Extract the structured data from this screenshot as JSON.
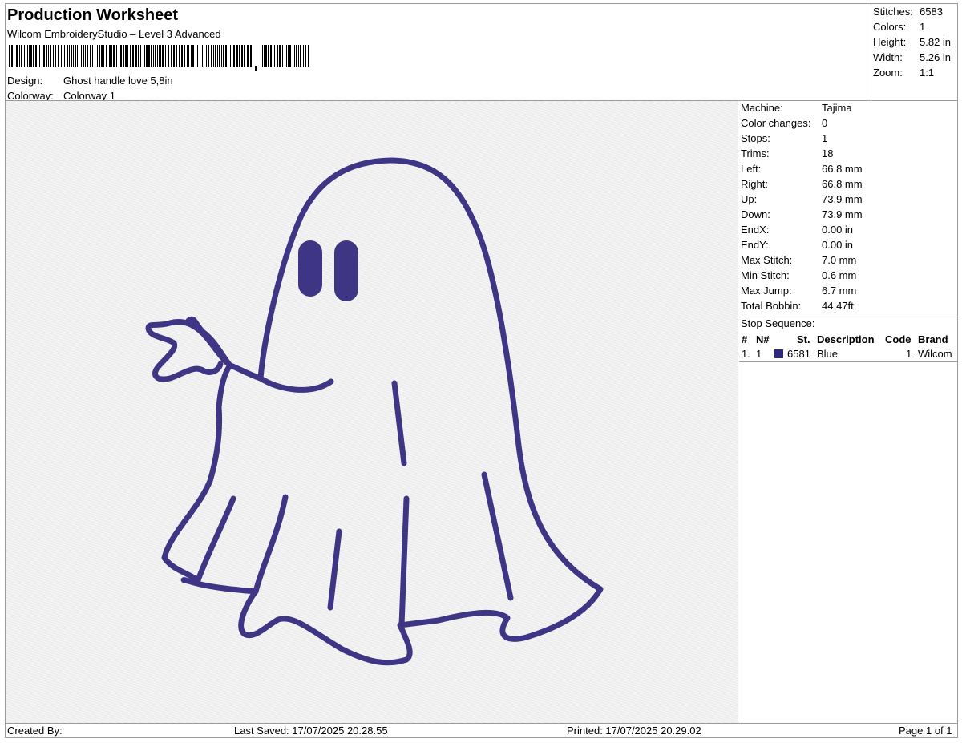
{
  "header": {
    "title": "Production Worksheet",
    "software": "Wilcom EmbroideryStudio – Level 3 Advanced",
    "design_label": "Design:",
    "design_value": "Ghost handle love 5,8in",
    "colorway_label": "Colorway:",
    "colorway_value": "Colorway 1"
  },
  "summary": {
    "stitches_label": "Stitches:",
    "stitches": "6583",
    "colors_label": "Colors:",
    "colors": "1",
    "height_label": "Height:",
    "height": "5.82 in",
    "width_label": "Width:",
    "width": "5.26 in",
    "zoom_label": "Zoom:",
    "zoom": "1:1"
  },
  "details": [
    {
      "label": "Machine:",
      "value": "Tajima"
    },
    {
      "label": "Color changes:",
      "value": "0"
    },
    {
      "label": "Stops:",
      "value": "1"
    },
    {
      "label": "Trims:",
      "value": "18"
    },
    {
      "label": "Left:",
      "value": "66.8 mm"
    },
    {
      "label": "Right:",
      "value": "66.8 mm"
    },
    {
      "label": "Up:",
      "value": "73.9 mm"
    },
    {
      "label": "Down:",
      "value": "73.9 mm"
    },
    {
      "label": "EndX:",
      "value": "0.00 in"
    },
    {
      "label": "EndY:",
      "value": "0.00 in"
    },
    {
      "label": "Max Stitch:",
      "value": "7.0 mm"
    },
    {
      "label": "Min Stitch:",
      "value": "0.6 mm"
    },
    {
      "label": "Max Jump:",
      "value": "6.7 mm"
    },
    {
      "label": "Total Bobbin:",
      "value": "44.47ft"
    }
  ],
  "stop_sequence": {
    "title": "Stop Sequence:",
    "columns": [
      "#",
      "N#",
      "St.",
      "Description",
      "Code",
      "Brand"
    ],
    "rows": [
      {
        "index": "1.",
        "n": "1",
        "st": "6581",
        "description": "Blue",
        "code": "1",
        "brand": "Wilcom",
        "color": "#2e2a7a"
      }
    ]
  },
  "thread_color": "#3f3585",
  "footer": {
    "created_by": "Created By:",
    "last_saved": "Last Saved: 17/07/2025 20.28.55",
    "printed": "Printed: 17/07/2025 20.29.02",
    "page": "Page 1 of 1"
  }
}
